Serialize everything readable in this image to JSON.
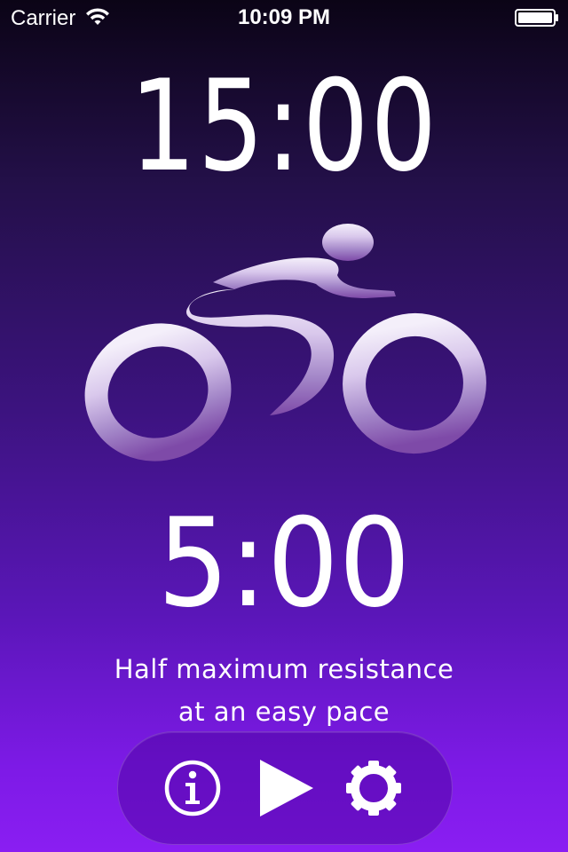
{
  "status_bar": {
    "carrier": "Carrier",
    "time": "10:09 PM"
  },
  "timer": {
    "total_time": "15:00",
    "interval_time": "5:00"
  },
  "instruction": {
    "line1": "Half maximum resistance",
    "line2": "at an easy pace"
  },
  "icons": {
    "cyclist": "cyclist-icon",
    "info": "info-icon",
    "play": "play-icon",
    "settings": "gear-icon",
    "wifi": "wifi-icon",
    "battery": "battery-icon"
  },
  "colors": {
    "background_top": "#0b0416",
    "background_bottom": "#8a1ef2",
    "text": "#ffffff",
    "icon_fill": "#e9dff5"
  },
  "battery_level": 1.0
}
